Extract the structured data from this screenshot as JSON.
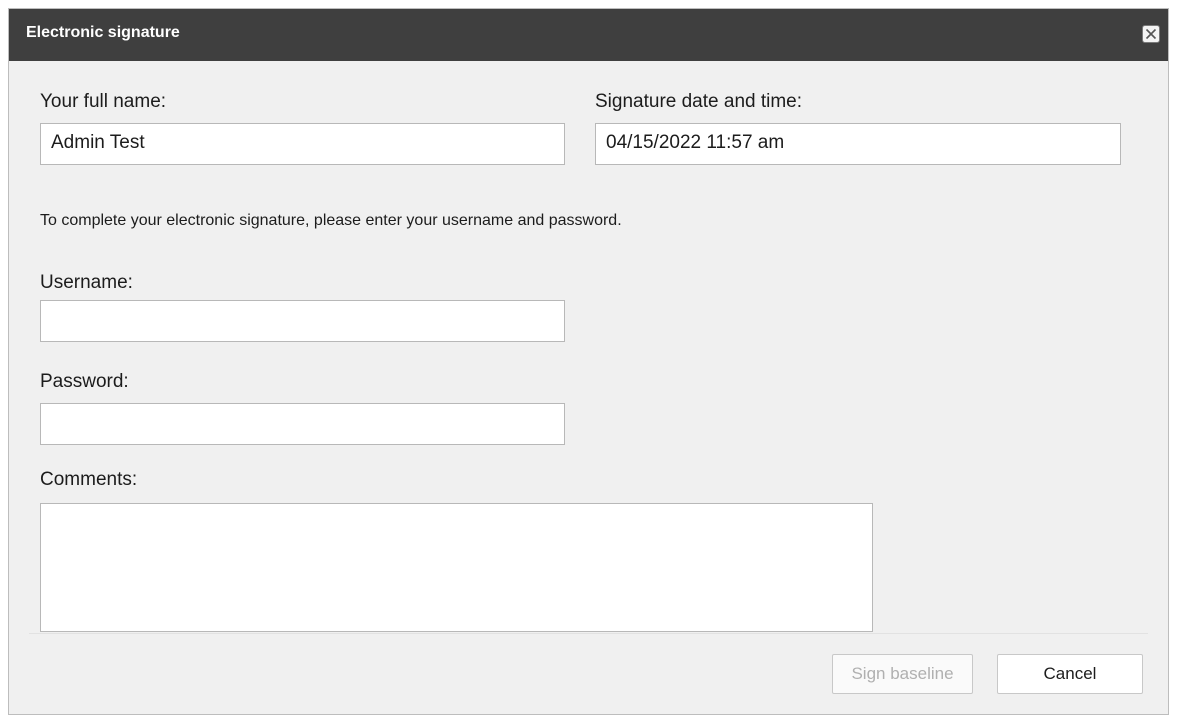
{
  "dialog": {
    "title": "Electronic signature",
    "close_icon": "close-icon"
  },
  "form": {
    "full_name_label": "Your full name:",
    "full_name_value": "Admin Test",
    "datetime_label": "Signature date and time:",
    "datetime_value": "04/15/2022 11:57 am",
    "instructions": "To complete your electronic signature, please enter your username and password.",
    "username_label": "Username:",
    "username_value": "",
    "password_label": "Password:",
    "password_value": "",
    "comments_label": "Comments:",
    "comments_value": ""
  },
  "footer": {
    "sign_label": "Sign baseline",
    "cancel_label": "Cancel"
  }
}
